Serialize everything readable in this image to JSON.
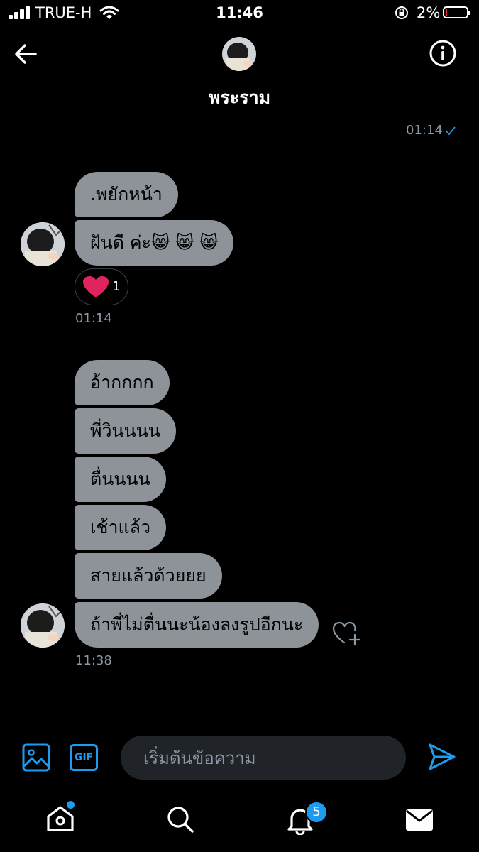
{
  "status_bar": {
    "carrier": "TRUE-H",
    "time": "11:46",
    "battery_percent": "2%",
    "icons": [
      "signal-icon",
      "wifi-icon",
      "rotation-lock-icon",
      "battery-icon"
    ]
  },
  "header": {
    "title": "พระราม",
    "icons": [
      "back-arrow-icon",
      "info-icon"
    ]
  },
  "messages": {
    "sent_meta": "01:14",
    "group1": {
      "bubbles": [
        ".พยักหน้า",
        "ฝันดี ค่ะ😸 😸 😸"
      ],
      "reaction_count": "1",
      "time": "01:14"
    },
    "group2": {
      "bubbles": [
        "อ้ากกกก",
        "พี่วินนนน",
        "ตื่นนนน",
        "เช้าแล้ว",
        "สายแล้วด้วยยย",
        "ถ้าพี่ไม่ตื่นนะน้องลงรูปอีกนะ"
      ],
      "time": "11:38"
    }
  },
  "composer": {
    "placeholder": "เริ่มต้นข้อความ",
    "gif_label": "GIF",
    "icons": [
      "image-icon",
      "gif-icon",
      "send-icon"
    ]
  },
  "tab_bar": {
    "notification_count": "5",
    "icons": [
      "home-icon",
      "search-icon",
      "notifications-icon",
      "messages-icon"
    ]
  },
  "colors": {
    "background": "#000000",
    "bubble": "#8e9299",
    "accent": "#1d9bf0",
    "meta_text": "#8b98a5",
    "heart": "#e0245e"
  }
}
